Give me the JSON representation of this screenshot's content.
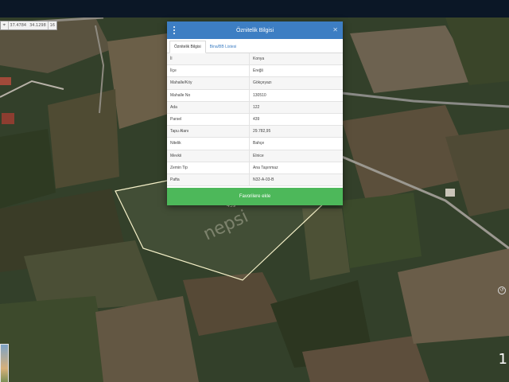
{
  "coords": {
    "lat": "37.4784",
    "lon": "34.1298",
    "zoom": "16"
  },
  "modal": {
    "title": "Öznitelik Bilgisi",
    "tabs": [
      {
        "label": "Öznitelik Bilgisi",
        "active": true
      },
      {
        "label": "Bina/BB Listesi",
        "active": false
      }
    ],
    "rows": [
      {
        "key": "İl",
        "value": "Konya"
      },
      {
        "key": "İlçe",
        "value": "Ereğli"
      },
      {
        "key": "Mahalle/Köy",
        "value": "Gökçeyazı"
      },
      {
        "key": "Mahalle No",
        "value": "130510"
      },
      {
        "key": "Ada",
        "value": "122"
      },
      {
        "key": "Parsel",
        "value": "439"
      },
      {
        "key": "Tapu Alanı",
        "value": "29.782,95"
      },
      {
        "key": "Nitelik",
        "value": "Bahçe"
      },
      {
        "key": "Mevkii",
        "value": "Elnice"
      },
      {
        "key": "Zemin Tip",
        "value": "Ana Taşınmaz"
      },
      {
        "key": "Pafta",
        "value": "N32-A-03-B"
      }
    ],
    "favorite_button": "Favorilere ekle"
  },
  "map": {
    "watermark": "nepsi",
    "parcel_number": "439",
    "scale_digit": "1"
  },
  "colors": {
    "header": "#3d7ec3",
    "button": "#4db85a",
    "parcel_outline": "#f5f0c8"
  }
}
